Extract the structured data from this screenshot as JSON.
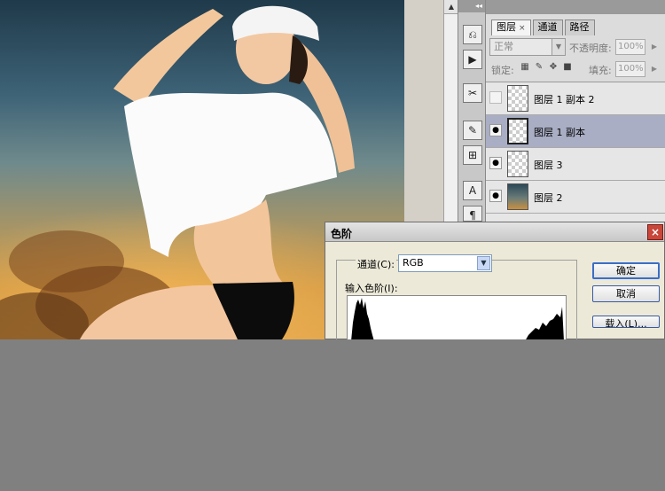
{
  "layers_panel": {
    "tabs": [
      {
        "label": "图层",
        "close": "×"
      },
      {
        "label": "通道"
      },
      {
        "label": "路径"
      }
    ],
    "blend_mode": "正常",
    "opacity_label": "不透明度:",
    "opacity_value": "100%",
    "lock_label": "锁定:",
    "fill_label": "填充:",
    "fill_value": "100%",
    "layers": [
      {
        "name": "图层 1 副本 2",
        "visible": false,
        "selected": false
      },
      {
        "name": "图层 1 副本",
        "visible": true,
        "selected": true
      },
      {
        "name": "图层 3",
        "visible": true,
        "selected": false
      },
      {
        "name": "图层 2",
        "visible": true,
        "selected": false
      }
    ]
  },
  "levels_dialog": {
    "title": "色阶",
    "close": "×",
    "channel_label": "通道(C):",
    "channel_value": "RGB",
    "input_levels_label": "输入色阶(I):",
    "ok_button": "确定",
    "cancel_button": "取消",
    "load_button": "载入(L)..."
  },
  "icons": {
    "eye": "eye-icon",
    "close": "close-icon",
    "dropdown": "chevron-down-icon"
  }
}
